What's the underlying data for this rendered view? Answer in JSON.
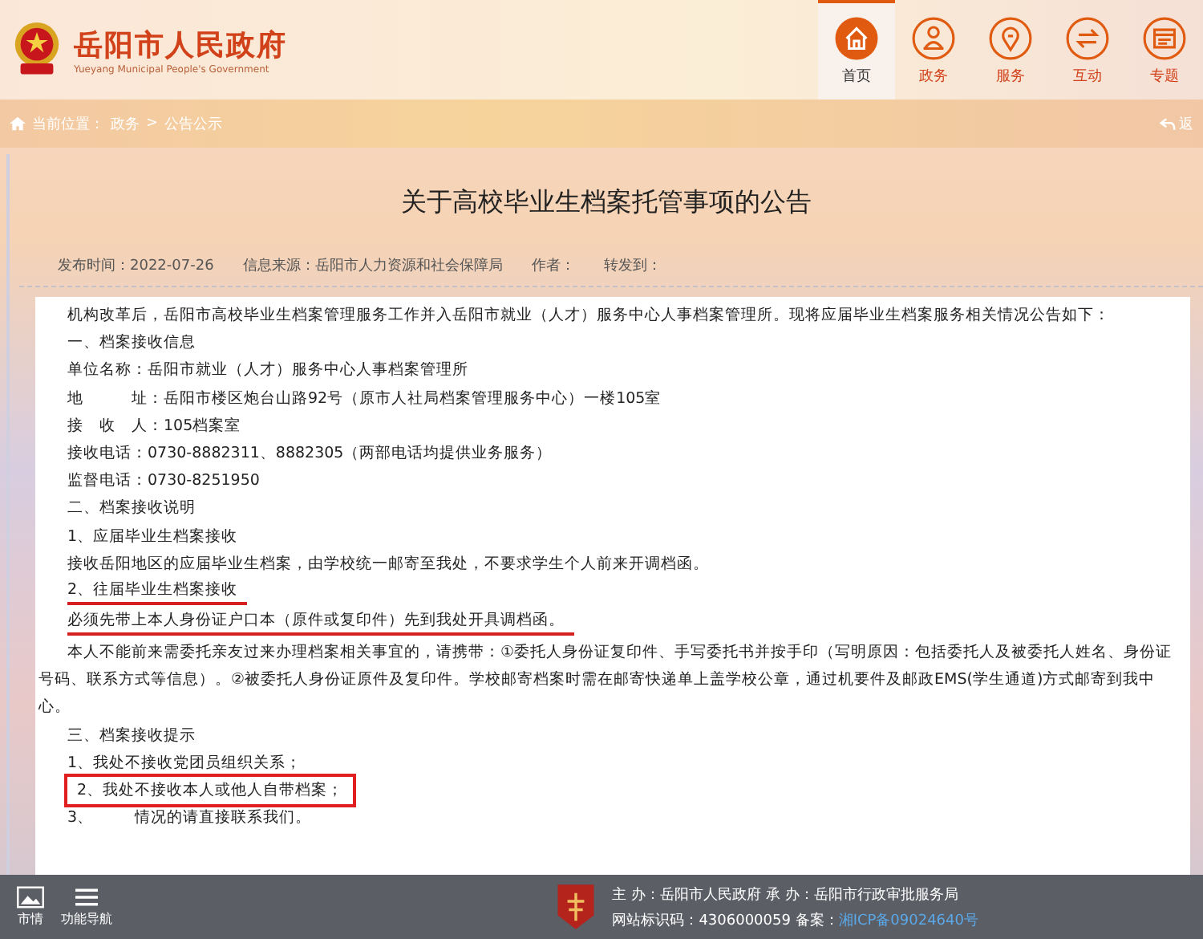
{
  "header": {
    "site_name": "岳阳市人民政府",
    "site_name_en": "Yueyang Municipal People's Government"
  },
  "nav": [
    {
      "label": "首页",
      "selected": true
    },
    {
      "label": "政务",
      "selected": false
    },
    {
      "label": "服务",
      "selected": false
    },
    {
      "label": "互动",
      "selected": false
    },
    {
      "label": "专题",
      "selected": false
    }
  ],
  "breadcrumb": {
    "label": "当前位置：",
    "items": [
      "政务",
      "公告公示"
    ],
    "separator": ">",
    "back": "返"
  },
  "article": {
    "title": "关于高校毕业生档案托管事项的公告",
    "meta": [
      "发布时间：2022-07-26",
      "信息来源：岳阳市人力资源和社会保障局",
      "作者：",
      "转发到："
    ],
    "lines": [
      {
        "parts": [
          "机构改革后，岳阳市高校毕业生档案管理服务工作并入岳阳市就业（人才）服务中心人事档案管理所。现将应届毕业生档案服务相关情况公告如下："
        ],
        "underlined": false,
        "boxed": false
      },
      {
        "parts": [
          "一、档案接收信息"
        ],
        "underlined": false,
        "boxed": false
      },
      {
        "parts": [
          "单位名称：岳阳市就业（人才）服务中心人事档案管理所"
        ],
        "underlined": false,
        "boxed": false
      },
      {
        "parts": [
          "地　　　址：岳阳市楼区炮台山路92号（原市人社局档案管理服务中心）一楼105室"
        ],
        "underlined": false,
        "boxed": false
      },
      {
        "parts": [
          "接　收　人：105档案室"
        ],
        "underlined": false,
        "boxed": false
      },
      {
        "parts": [
          "接收电话：0730-8882311、8882305（两部电话均提供业务服务）"
        ],
        "underlined": false,
        "boxed": false
      },
      {
        "parts": [
          "监督电话：0730-8251950"
        ],
        "underlined": false,
        "boxed": false
      },
      {
        "parts": [
          "二、档案接收说明"
        ],
        "underlined": false,
        "boxed": false
      },
      {
        "parts": [
          "1、应届毕业生档案接收"
        ],
        "underlined": false,
        "boxed": false
      },
      {
        "parts": [
          "接收岳阳地区的应届毕业生档案，由学校统一邮寄至我处，不要求学生个人前来开调档函。"
        ],
        "underlined": false,
        "boxed": false
      },
      {
        "parts": [
          "2、往届毕业生档案接收"
        ],
        "underlined": true,
        "boxed": false
      },
      {
        "parts": [
          "必须先带上本人身份证户口本（原件或复印件）先到我处开具调档函。"
        ],
        "underlined": true,
        "boxed": false
      },
      {
        "parts": [
          "本人不能前来需委托亲友过来办理档案相关事宜的，请携带：①委托人身份证复印件、手写委托书并按手印（写明原因：包括委托人及被委托人姓名、身份证号码、联系方式等信息）。②被委托人身份证原件及复印件。学校邮寄档案时需在邮寄快递单上盖学校公章，通过机要件及邮政EMS(学生通道)方式邮寄到我中心。"
        ],
        "underlined": false,
        "boxed": false
      },
      {
        "parts": [
          "三、档案接收提示"
        ],
        "underlined": false,
        "boxed": false
      },
      {
        "parts": [
          "1、我处不接收党团员组织关系；"
        ],
        "underlined": false,
        "boxed": false
      },
      {
        "parts": [
          "2、我处不接收本人或他人自带档案；"
        ],
        "underlined": false,
        "boxed": true
      },
      {
        "parts": [
          "3、",
          "情况的请直接联系我们。"
        ],
        "underlined": false,
        "boxed": false
      }
    ]
  },
  "footer": {
    "tools": [
      "市情",
      "功能导航"
    ],
    "host": "主 办：岳阳市人民政府 承 办：岳阳市行政审批服务局",
    "site_code": "网站标识码：4306000059 备案：",
    "icp": "湘ICP备09024640号"
  }
}
